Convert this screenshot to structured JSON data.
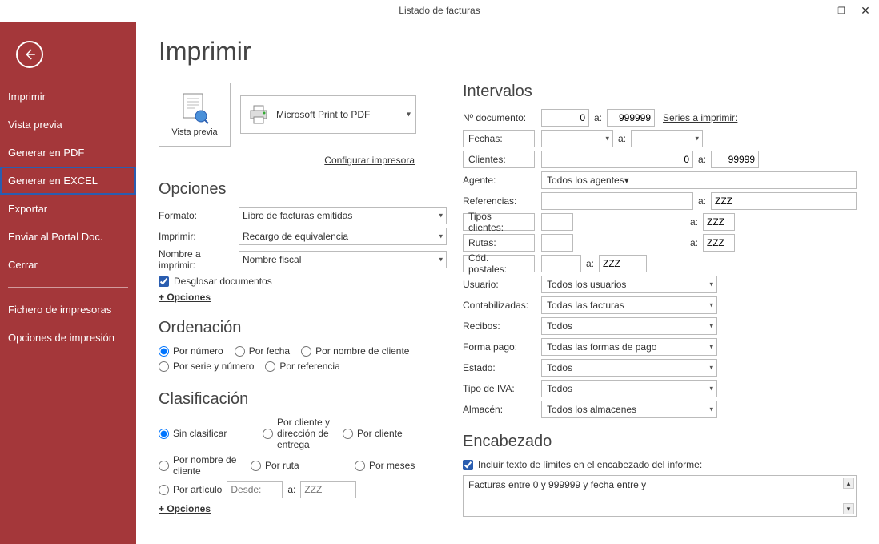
{
  "window": {
    "title": "Listado de facturas"
  },
  "sidebar": {
    "items": [
      {
        "label": "Imprimir"
      },
      {
        "label": "Vista previa"
      },
      {
        "label": "Generar en PDF"
      },
      {
        "label": "Generar en EXCEL"
      },
      {
        "label": "Exportar"
      },
      {
        "label": "Enviar al Portal Doc."
      },
      {
        "label": "Cerrar"
      }
    ],
    "secondary": [
      {
        "label": "Fichero de impresoras"
      },
      {
        "label": "Opciones de impresión"
      }
    ]
  },
  "header": {
    "h1": "Imprimir"
  },
  "preview_btn": "Vista previa",
  "printer": "Microsoft Print to PDF",
  "configure_link": "Configurar impresora",
  "opciones": {
    "title": "Opciones",
    "formato_label": "Formato:",
    "formato_value": "Libro de facturas emitidas",
    "imprimir_label": "Imprimir:",
    "imprimir_value": "Recargo de equivalencia",
    "nombre_label": "Nombre a imprimir:",
    "nombre_value": "Nombre fiscal",
    "desglosar": "Desglosar documentos",
    "plus": "+ Opciones"
  },
  "ordenacion": {
    "title": "Ordenación",
    "por_numero": "Por número",
    "por_fecha": "Por fecha",
    "por_nombre": "Por nombre de cliente",
    "por_serie": "Por serie y número",
    "por_referencia": "Por referencia"
  },
  "clasificacion": {
    "title": "Clasificación",
    "sin": "Sin clasificar",
    "cli_dir": "Por cliente y dirección de entrega",
    "cliente": "Por cliente",
    "nombre": "Por nombre de cliente",
    "ruta": "Por ruta",
    "meses": "Por meses",
    "articulo": "Por artículo",
    "desde": "Desde:",
    "a": "a:",
    "zzz": "ZZZ",
    "plus": "+ Opciones"
  },
  "intervalos": {
    "title": "Intervalos",
    "ndoc_label": "Nº documento:",
    "ndoc_from": "0",
    "a": "a:",
    "ndoc_to": "999999",
    "series_link": "Series a imprimir:",
    "fechas_btn": "Fechas:",
    "clientes_btn": "Clientes:",
    "clientes_from": "0",
    "clientes_to": "99999",
    "agente_label": "Agente:",
    "agente_value": "Todos los agentes",
    "ref_label": "Referencias:",
    "ref_to": "ZZZ",
    "tipos_btn": "Tipos clientes:",
    "tipos_to": "ZZZ",
    "rutas_btn": "Rutas:",
    "rutas_to": "ZZZ",
    "cp_btn": "Cód. postales:",
    "cp_to": "ZZZ",
    "usuario_label": "Usuario:",
    "usuario_value": "Todos los usuarios",
    "contab_label": "Contabilizadas:",
    "contab_value": "Todas las facturas",
    "recibos_label": "Recibos:",
    "recibos_value": "Todos",
    "fpago_label": "Forma pago:",
    "fpago_value": "Todas las formas de pago",
    "estado_label": "Estado:",
    "estado_value": "Todos",
    "tiva_label": "Tipo de IVA:",
    "tiva_value": "Todos",
    "almacen_label": "Almacén:",
    "almacen_value": "Todos los almacenes"
  },
  "encabezado": {
    "title": "Encabezado",
    "chk": "Incluir texto de límites en el encabezado del informe:",
    "text": "Facturas entre 0 y 999999 y fecha entre  y"
  }
}
